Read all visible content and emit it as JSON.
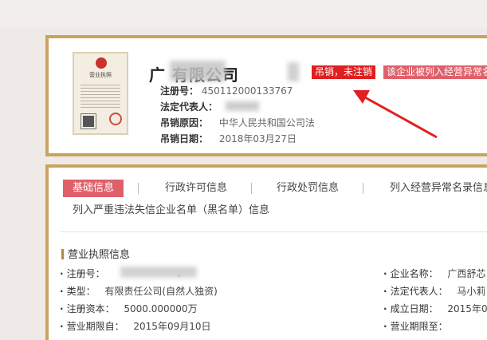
{
  "company": {
    "name_visible": "广 有限公司",
    "status_tag": "吊销，未注销",
    "abnormal_tag": "该企业被列入经营异常名",
    "fields": [
      {
        "label": "注册号：",
        "value": "450112000133767"
      },
      {
        "label": "法定代表人：",
        "value": ""
      },
      {
        "label": "吊销原因：",
        "value": "中华人民共和国公司法"
      },
      {
        "label": "吊销日期：",
        "value": "2018年03月27日"
      }
    ],
    "license_title": "营业执照"
  },
  "tabs": [
    {
      "label": "基础信息",
      "active": true
    },
    {
      "label": "行政许可信息",
      "active": false
    },
    {
      "label": "行政处罚信息",
      "active": false
    },
    {
      "label": "列入经营异常名录信息",
      "active": false
    },
    {
      "label": "列入严重违法失信企业名单（黑名单）信息",
      "active": false
    }
  ],
  "section_title": "营业执照信息",
  "info_left": [
    {
      "label": "注册号：",
      "value": "7"
    },
    {
      "label": "类型：",
      "value": "有限责任公司(自然人独资)"
    },
    {
      "label": "注册资本：",
      "value": "5000.000000万"
    },
    {
      "label": "营业期限自：",
      "value": "2015年09月10日"
    }
  ],
  "info_right": [
    {
      "label": "企业名称：",
      "value": "广西舒芯"
    },
    {
      "label": "法定代表人：",
      "value": "马小莉"
    },
    {
      "label": "成立日期：",
      "value": "2015年0"
    },
    {
      "label": "营业期限至：",
      "value": ""
    }
  ],
  "colors": {
    "gold_border": "#c9a45c",
    "red_tag": "#e02020",
    "pink_tag": "#e0606a",
    "arrow": "#e02020"
  }
}
